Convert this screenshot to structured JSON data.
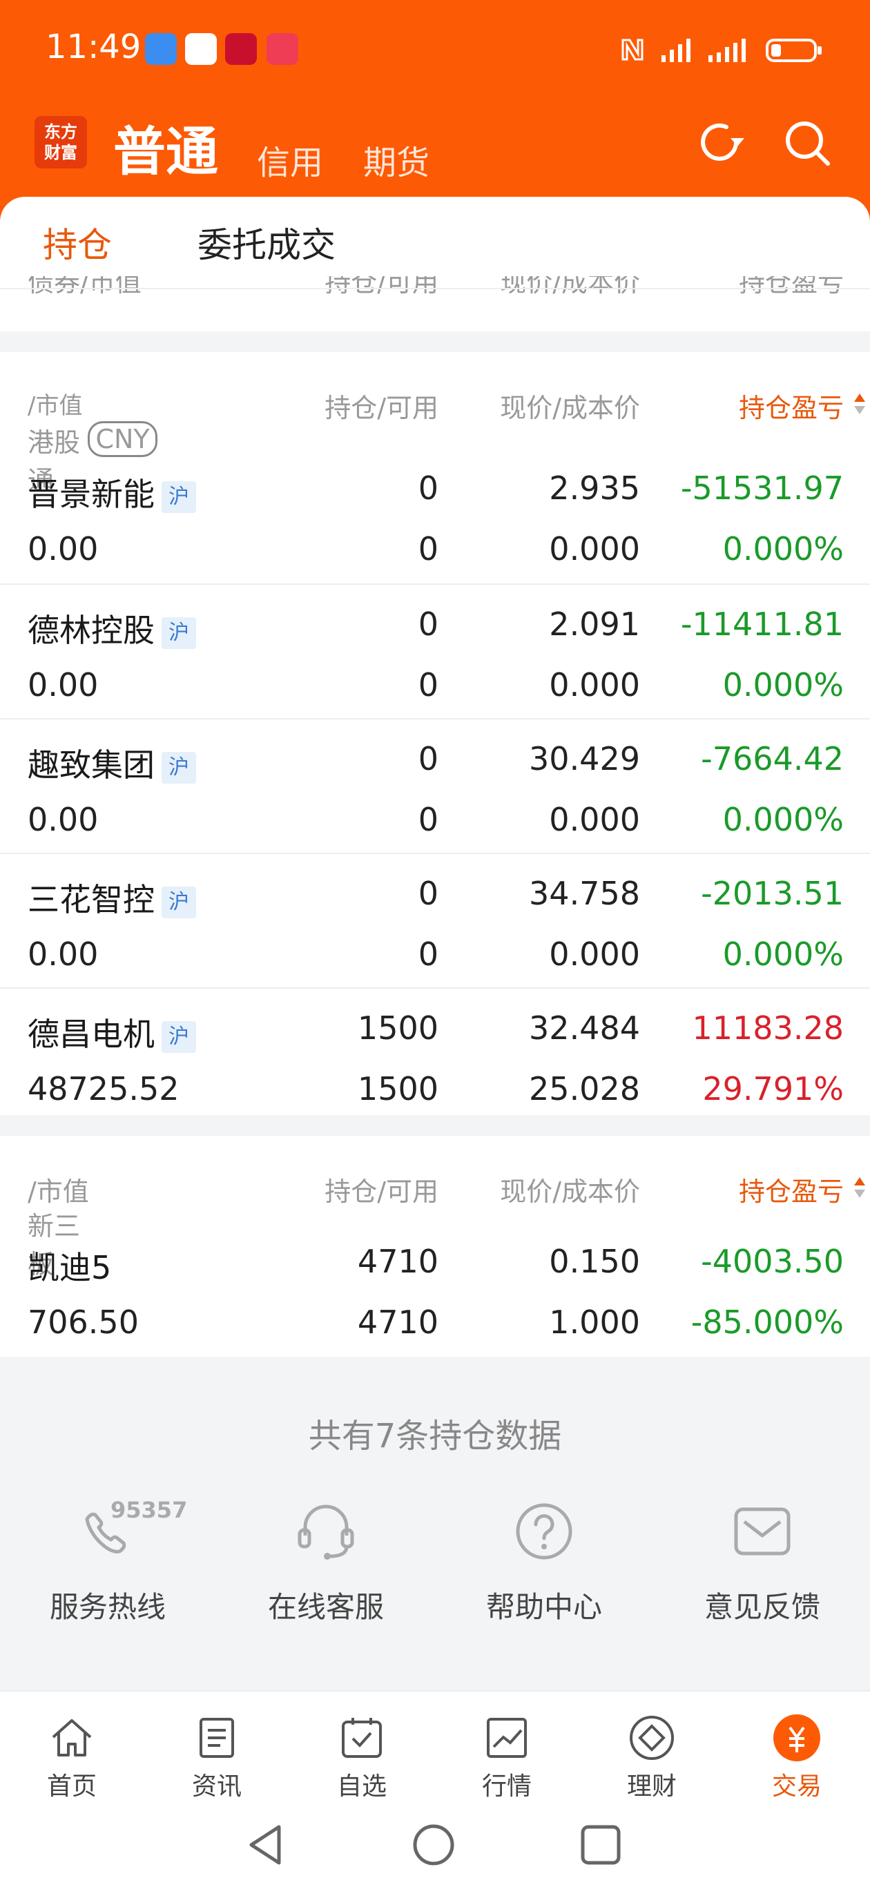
{
  "status": {
    "time": "11:49"
  },
  "header": {
    "logo_text": "东方\n财富",
    "account_main": "普通",
    "tabs": [
      "信用",
      "期货"
    ]
  },
  "subtabs": [
    "持仓",
    "委托成交"
  ],
  "prev_section_header": {
    "c1": "债券/市值",
    "c2": "持仓/可用",
    "c3": "现价/成本价",
    "c4": "持仓盈亏"
  },
  "sections": [
    {
      "title": "港股通",
      "subtitle": "/市值",
      "currency": "CNY",
      "col2": "持仓/可用",
      "col3": "现价/成本价",
      "col4": "持仓盈亏",
      "rows": [
        {
          "name": "晋景新能",
          "market": "沪",
          "value": "0.00",
          "hold": "0",
          "avail": "0",
          "price": "2.935",
          "cost": "0.000",
          "pl": "-51531.97",
          "pl_pct": "0.000%",
          "sign": "neg"
        },
        {
          "name": "德林控股",
          "market": "沪",
          "value": "0.00",
          "hold": "0",
          "avail": "0",
          "price": "2.091",
          "cost": "0.000",
          "pl": "-11411.81",
          "pl_pct": "0.000%",
          "sign": "neg"
        },
        {
          "name": "趣致集团",
          "market": "沪",
          "value": "0.00",
          "hold": "0",
          "avail": "0",
          "price": "30.429",
          "cost": "0.000",
          "pl": "-7664.42",
          "pl_pct": "0.000%",
          "sign": "neg"
        },
        {
          "name": "三花智控",
          "market": "沪",
          "value": "0.00",
          "hold": "0",
          "avail": "0",
          "price": "34.758",
          "cost": "0.000",
          "pl": "-2013.51",
          "pl_pct": "0.000%",
          "sign": "neg"
        },
        {
          "name": "德昌电机",
          "market": "沪",
          "value": "48725.52",
          "hold": "1500",
          "avail": "1500",
          "price": "32.484",
          "cost": "25.028",
          "pl": "11183.28",
          "pl_pct": "29.791%",
          "sign": "pos"
        }
      ]
    },
    {
      "title": "新三板",
      "subtitle": "/市值",
      "col2": "持仓/可用",
      "col3": "现价/成本价",
      "col4": "持仓盈亏",
      "rows": [
        {
          "name": "凯迪5",
          "value": "706.50",
          "hold": "4710",
          "avail": "4710",
          "price": "0.150",
          "cost": "1.000",
          "pl": "-4003.50",
          "pl_pct": "-85.000%",
          "sign": "neg"
        }
      ]
    }
  ],
  "summary": "共有7条持仓数据",
  "services": [
    {
      "label": "服务热线",
      "badge": "95357",
      "icon": "phone-icon"
    },
    {
      "label": "在线客服",
      "icon": "headset-icon"
    },
    {
      "label": "帮助中心",
      "icon": "question-icon"
    },
    {
      "label": "意见反馈",
      "icon": "mail-icon"
    }
  ],
  "nav": [
    {
      "label": "首页",
      "icon": "home-icon"
    },
    {
      "label": "资讯",
      "icon": "news-icon"
    },
    {
      "label": "自选",
      "icon": "watchlist-icon"
    },
    {
      "label": "行情",
      "icon": "market-icon"
    },
    {
      "label": "理财",
      "icon": "wealth-icon"
    },
    {
      "label": "交易",
      "icon": "trade-icon",
      "active": true
    }
  ],
  "colors": {
    "brand": "#fd5a05",
    "accent": "#e8580c",
    "loss": "#1a9a29",
    "gain": "#d8222a"
  }
}
